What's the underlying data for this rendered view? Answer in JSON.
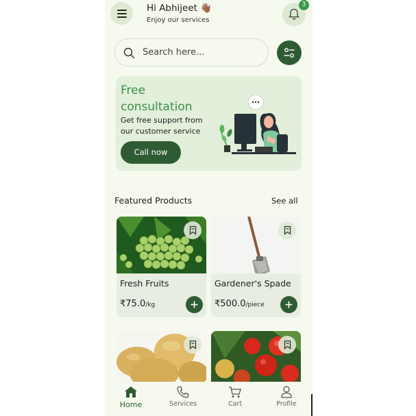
{
  "header": {
    "greeting": "Hi Abhijeet 👋🏾",
    "subtitle": "Enjoy our services",
    "notification_count": "3"
  },
  "search": {
    "placeholder": "Search here..."
  },
  "banner": {
    "title": "Free consultation",
    "text": "Get free support from our customer service",
    "button": "Call now"
  },
  "featured": {
    "title": "Featured Products",
    "see_all": "See all",
    "products": [
      {
        "name": "Fresh Fruits",
        "price": "₹75.0",
        "unit": "/kg"
      },
      {
        "name": "Gardener's Spade",
        "price": "₹500.0",
        "unit": "/piece"
      },
      {
        "name": "",
        "price": "",
        "unit": ""
      },
      {
        "name": "",
        "price": "",
        "unit": ""
      }
    ]
  },
  "nav": {
    "items": [
      {
        "label": "Home",
        "icon": "home-icon",
        "active": true
      },
      {
        "label": "Services",
        "icon": "phone-icon",
        "active": false
      },
      {
        "label": "Cart",
        "icon": "cart-icon",
        "active": false
      },
      {
        "label": "Profile",
        "icon": "user-icon",
        "active": false
      }
    ]
  },
  "colors": {
    "primary": "#2f5b33",
    "accent": "#3f8d4c",
    "background": "#f5f9ee",
    "banner": "#e1efdb"
  }
}
